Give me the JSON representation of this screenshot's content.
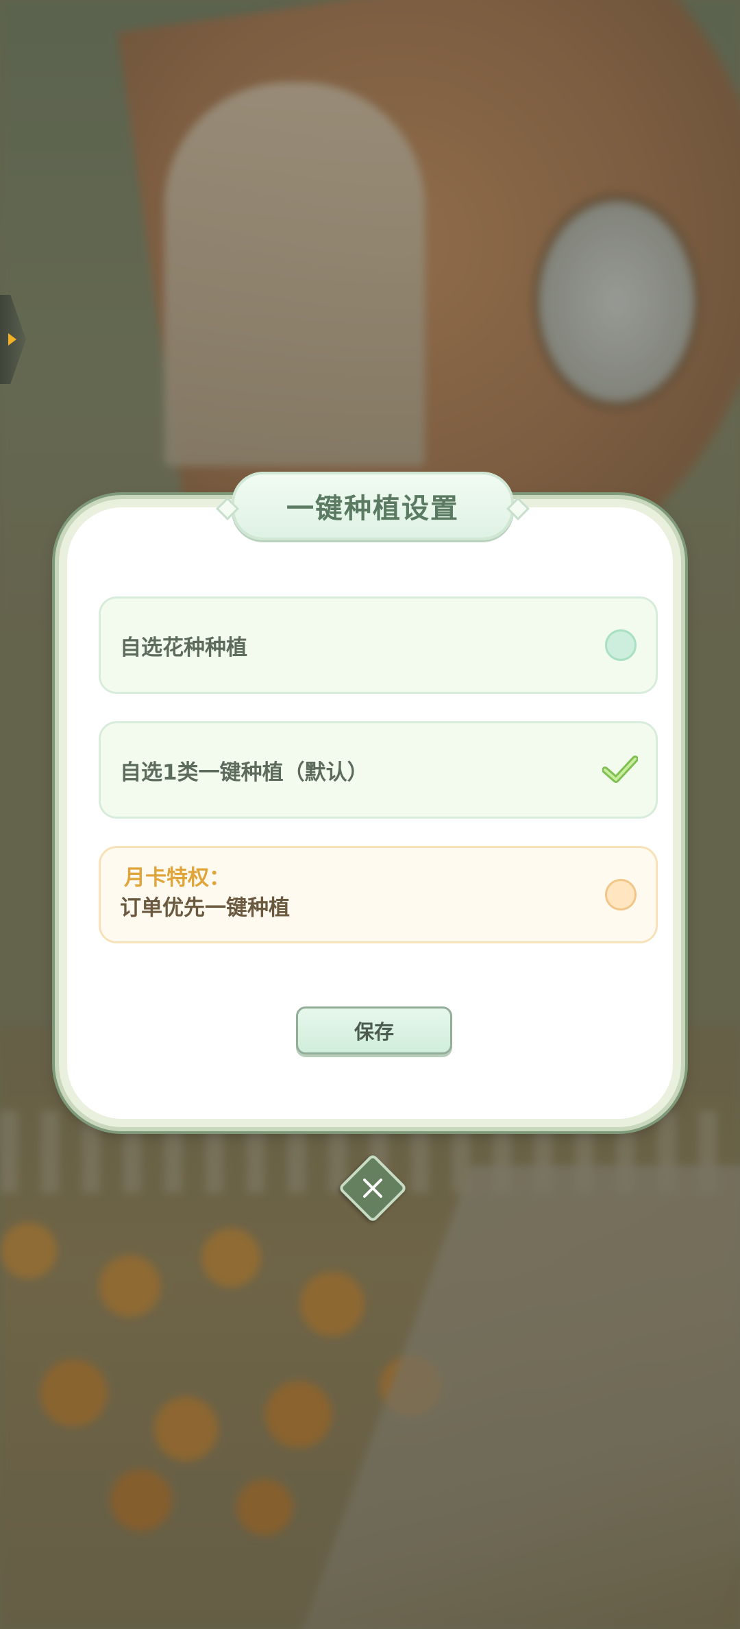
{
  "dialog": {
    "title": "一键种植设置",
    "options": [
      {
        "label": "自选花种种植",
        "state": "unselected"
      },
      {
        "label": "自选1类一键种植（默认）",
        "state": "selected"
      },
      {
        "label_top": "月卡特权：",
        "label": "订单优先一键种植",
        "state": "unselected"
      }
    ],
    "save_label": "保存"
  },
  "icons": {
    "side_tab": "chevron-right-icon",
    "check": "check-icon",
    "close": "close-icon"
  },
  "colors": {
    "accent_green": "#5a7a62",
    "gold_text": "#e0a53a",
    "close_button": "#65805e"
  }
}
